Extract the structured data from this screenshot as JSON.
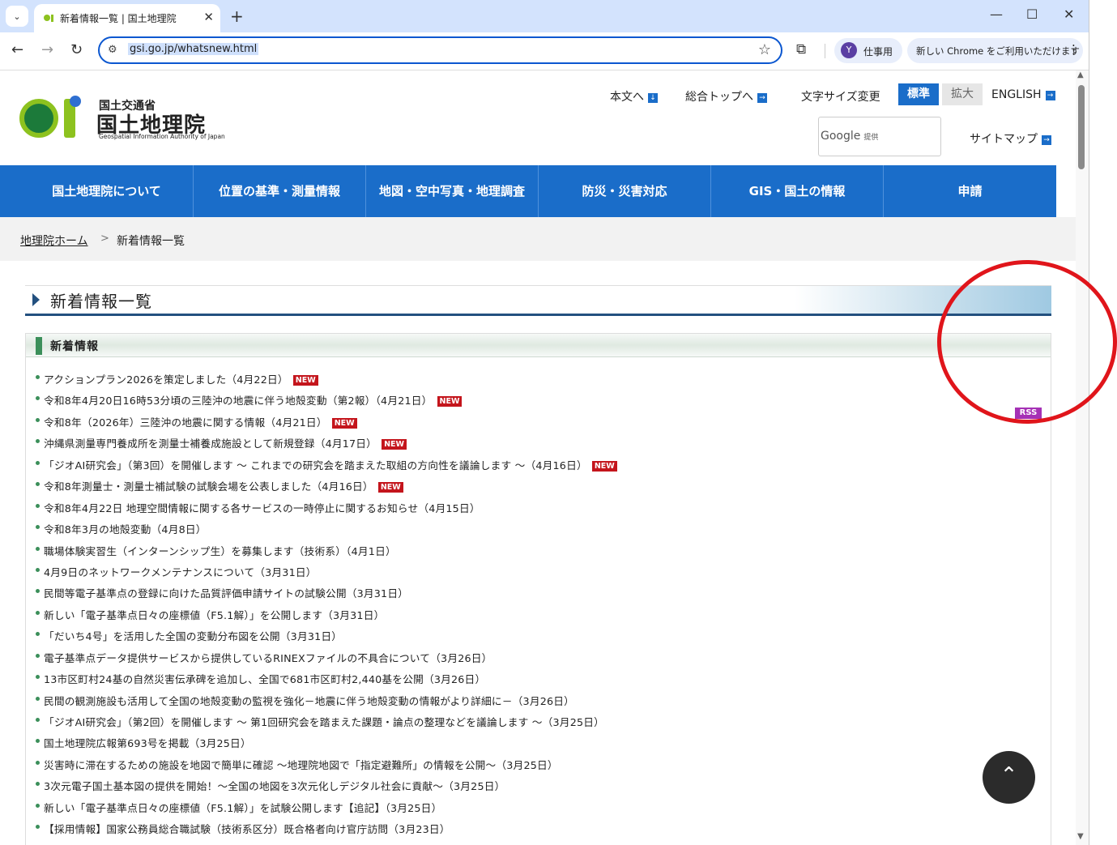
{
  "browser": {
    "tab_title": "新着情報一覧 | 国土地理院",
    "tab_close": "✕",
    "new_tab": "+",
    "url": "gsi.go.jp/whatsnew.html",
    "profile_initial": "Y",
    "profile_label": "仕事用",
    "update_label": "新しい Chrome をご利用いただけます",
    "window_controls": [
      "—",
      "☐",
      "✕"
    ]
  },
  "header": {
    "logo_org": "国土交通省",
    "logo_name": "国土地理院",
    "logo_en": "Geospatial Information Authority of Japan",
    "skip_link": "本文へ",
    "top_link": "総合トップへ",
    "font_size_label": "文字サイズ変更",
    "font_standard": "標準",
    "font_large": "拡大",
    "english": "ENGLISH",
    "search_brand": "Google",
    "search_suffix": "提供",
    "sitemap": "サイトマップ"
  },
  "nav": {
    "items": [
      {
        "label": "国土地理院について"
      },
      {
        "label": "位置の基準・測量情報"
      },
      {
        "label": "地図・空中写真・地理調査"
      },
      {
        "label": "防災・災害対応"
      },
      {
        "label": "GIS・国土の情報"
      },
      {
        "label": "申請"
      }
    ]
  },
  "breadcrumb": {
    "home": "地理院ホーム",
    "separator": ">",
    "current": "新着情報一覧"
  },
  "main": {
    "title": "新着情報一覧",
    "section_title": "新着情報",
    "rss": "RSS",
    "new_tag": "NEW",
    "news": [
      {
        "text": "アクションプラン2026を策定しました（4月22日）",
        "new": "NEW"
      },
      {
        "text": "令和8年4月20日16時53分頃の三陸沖の地震に伴う地殻変動（第2報）（4月21日）",
        "new": "NEW"
      },
      {
        "text": "令和8年（2026年）三陸沖の地震に関する情報（4月21日）",
        "new": "NEW"
      },
      {
        "text": "沖縄県測量専門養成所を測量士補養成施設として新規登録（4月17日）",
        "new": "NEW"
      },
      {
        "text": "「ジオAI研究会」（第3回）を開催します ～ これまでの研究会を踏まえた取組の方向性を議論します ～（4月16日）",
        "new": "NEW"
      },
      {
        "text": "令和8年測量士・測量士補試験の試験会場を公表しました（4月16日）",
        "new": "NEW"
      },
      {
        "text": "令和8年4月22日 地理空間情報に関する各サービスの一時停止に関するお知らせ（4月15日）",
        "new": ""
      },
      {
        "text": "令和8年3月の地殻変動（4月8日）",
        "new": ""
      },
      {
        "text": "職場体験実習生（インターンシップ生）を募集します（技術系）（4月1日）",
        "new": ""
      },
      {
        "text": "4月9日のネットワークメンテナンスについて（3月31日）",
        "new": ""
      },
      {
        "text": "民間等電子基準点の登録に向けた品質評価申請サイトの試験公開（3月31日）",
        "new": ""
      },
      {
        "text": "新しい「電子基準点日々の座標値（F5.1解）」を公開します（3月31日）",
        "new": ""
      },
      {
        "text": "「だいち4号」を活用した全国の変動分布図を公開（3月31日）",
        "new": ""
      },
      {
        "text": "電子基準点データ提供サービスから提供しているRINEXファイルの不具合について（3月26日）",
        "new": ""
      },
      {
        "text": "13市区町村24基の自然災害伝承碑を追加し、全国で681市区町村2,440基を公開（3月26日）",
        "new": ""
      },
      {
        "text": "民間の観測施設も活用して全国の地殻変動の監視を強化－地震に伴う地殻変動の情報がより詳細に－（3月26日）",
        "new": ""
      },
      {
        "text": "「ジオAI研究会」（第2回）を開催します ～ 第1回研究会を踏まえた課題・論点の整理などを議論します ～（3月25日）",
        "new": ""
      },
      {
        "text": "国土地理院広報第693号を掲載（3月25日）",
        "new": ""
      },
      {
        "text": "災害時に滞在するための施設を地図で簡単に確認 ～地理院地図で「指定避難所」の情報を公開～（3月25日）",
        "new": ""
      },
      {
        "text": "3次元電子国土基本図の提供を開始！～全国の地図を3次元化しデジタル社会に貢献～（3月25日）",
        "new": ""
      },
      {
        "text": "新しい「電子基準点日々の座標値（F5.1解）」を試験公開します【追記】（3月25日）",
        "new": ""
      },
      {
        "text": "【採用情報】国家公務員総合職試験（技術系区分）既合格者向け官庁訪問（3月23日）",
        "new": ""
      }
    ],
    "back_to_top": "⌃"
  }
}
